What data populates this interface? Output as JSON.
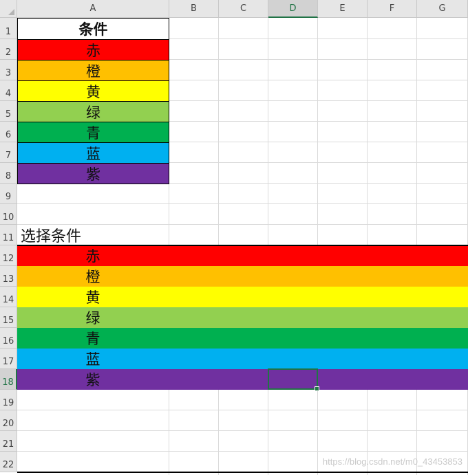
{
  "columns": [
    "A",
    "B",
    "C",
    "D",
    "E",
    "F",
    "G"
  ],
  "rows": [
    "1",
    "2",
    "3",
    "4",
    "5",
    "6",
    "7",
    "8",
    "9",
    "10",
    "11",
    "12",
    "13",
    "14",
    "15",
    "16",
    "17",
    "18",
    "19",
    "20",
    "21",
    "22"
  ],
  "active": {
    "column": "D",
    "row": "18"
  },
  "table1": {
    "header": "条件",
    "items": [
      {
        "label": "赤",
        "color": "#ff0000"
      },
      {
        "label": "橙",
        "color": "#ffc000"
      },
      {
        "label": "黄",
        "color": "#ffff00"
      },
      {
        "label": "绿",
        "color": "#92d050"
      },
      {
        "label": "青",
        "color": "#00b050"
      },
      {
        "label": "蓝",
        "color": "#00b0f0"
      },
      {
        "label": "紫",
        "color": "#7030a0"
      }
    ]
  },
  "section2": {
    "label": "选择条件",
    "items": [
      {
        "label": "赤",
        "color": "#ff0000"
      },
      {
        "label": "橙",
        "color": "#ffc000"
      },
      {
        "label": "黄",
        "color": "#ffff00"
      },
      {
        "label": "绿",
        "color": "#92d050"
      },
      {
        "label": "青",
        "color": "#00b050"
      },
      {
        "label": "蓝",
        "color": "#00b0f0"
      },
      {
        "label": "紫",
        "color": "#7030a0"
      }
    ]
  },
  "watermark": "https://blog.csdn.net/m0_43453853"
}
